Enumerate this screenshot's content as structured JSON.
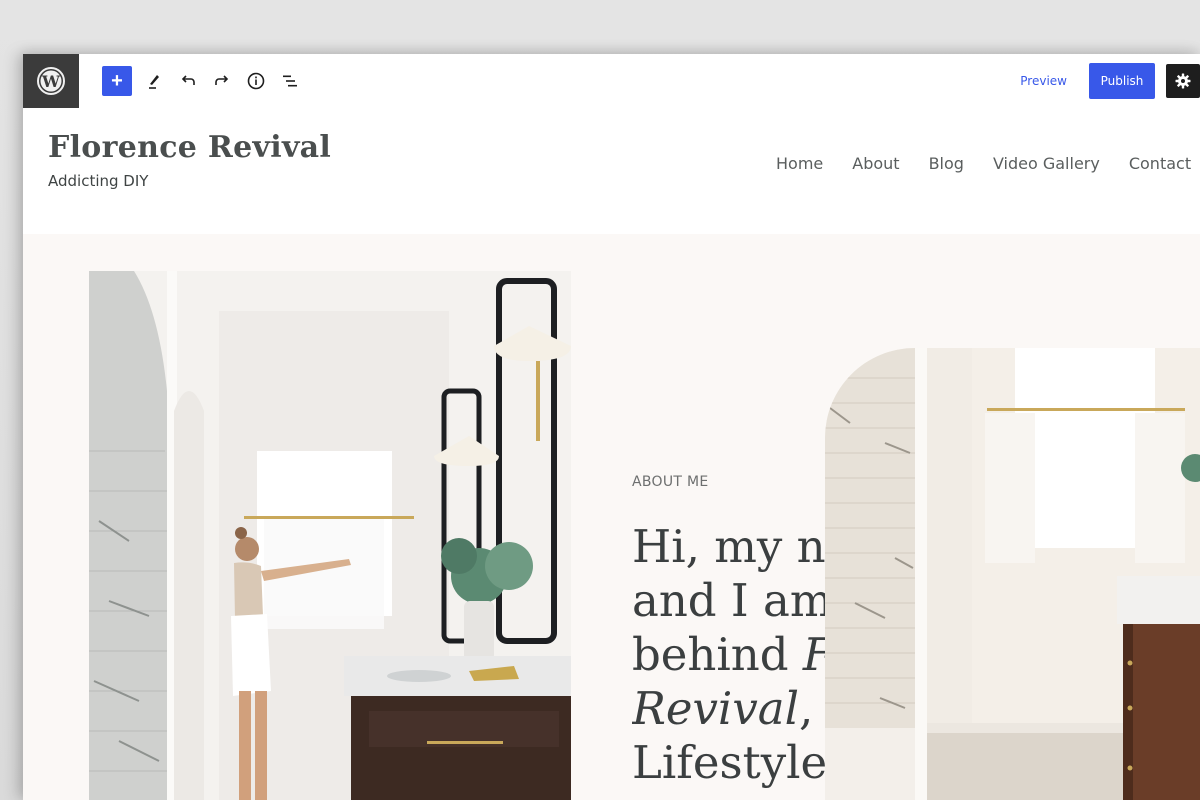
{
  "toolbar": {
    "logo_icon": "wordpress-logo-icon",
    "add_block_icon": "plus-icon",
    "tools_icon": "pencil-icon",
    "undo_icon": "undo-icon",
    "redo_icon": "redo-icon",
    "details_icon": "info-icon",
    "list_view_icon": "list-view-icon",
    "add_label": "+",
    "preview_label": "Preview",
    "publish_label": "Publish",
    "settings_icon": "gear-icon",
    "accent_color": "#3858e9"
  },
  "site": {
    "title": "Florence Revival",
    "tagline": "Addicting DIY"
  },
  "nav": {
    "items": [
      {
        "label": "Home"
      },
      {
        "label": "About"
      },
      {
        "label": "Blog"
      },
      {
        "label": "Video Gallery"
      },
      {
        "label": "Contact"
      }
    ]
  },
  "about": {
    "eyebrow": "ABOUT ME",
    "headline_lines": [
      "Hi, my name is",
      "and I am the",
      "behind ",
      "Revival",
      "Lifestyle"
    ],
    "headline_line3_italic": "Florence",
    "headline_line4_rest": ", a"
  },
  "images": {
    "left_alt": "Woman opening curtains in a white marble bathroom with dark wood vanity",
    "right_alt": "Bright bathroom with arched marble tile shower and wood vanity"
  }
}
